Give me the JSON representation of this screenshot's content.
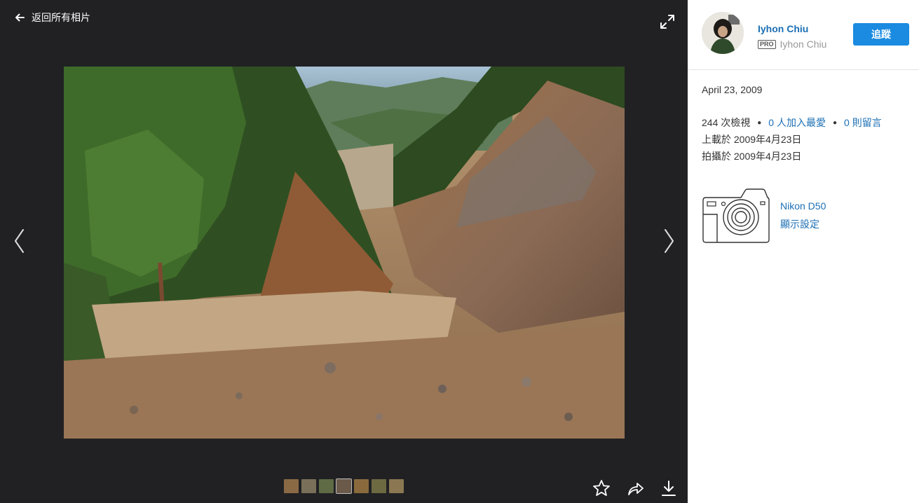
{
  "viewer": {
    "back_label": "返回所有相片",
    "thumbnails": [
      {
        "color": "#8a6a45"
      },
      {
        "color": "#7a6f58"
      },
      {
        "color": "#5e6b45"
      },
      {
        "color": "#6b5a4a"
      },
      {
        "color": "#8a6a3c"
      },
      {
        "color": "#6d6a42"
      },
      {
        "color": "#8b7852"
      }
    ]
  },
  "owner": {
    "name": "Iyhon Chiu",
    "pro_badge": "PRO",
    "subname": "Iyhon Chiu",
    "follow_label": "追蹤"
  },
  "info": {
    "date": "April 23, 2009",
    "views": "244 次檢視",
    "faves": "0 人加入最愛",
    "comments": "0 則留言",
    "uploaded": "上載於 2009年4月23日",
    "taken": "拍攝於 2009年4月23日"
  },
  "camera": {
    "model": "Nikon D50",
    "settings_label": "顯示設定"
  },
  "colors": {
    "viewer_bg": "#212124",
    "link": "#1b6fb4",
    "follow_button": "#1a8be0"
  }
}
